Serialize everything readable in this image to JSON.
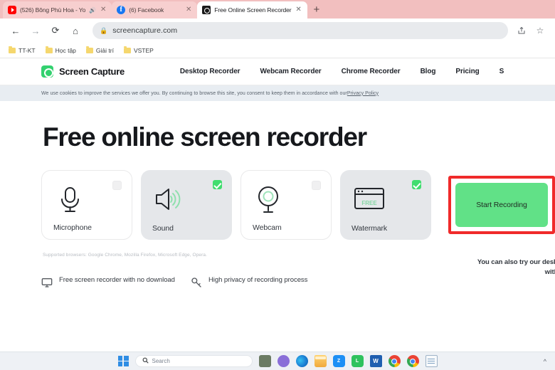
{
  "browser": {
    "tabs": [
      {
        "title": "(526) Bông Phù Hoa - Yo",
        "favicon": "youtube-icon",
        "muted": true,
        "active": false,
        "close_label": "✕"
      },
      {
        "title": "(6) Facebook",
        "favicon": "facebook-icon",
        "muted": false,
        "active": false,
        "close_label": "✕"
      },
      {
        "title": "Free Online Screen Recorder",
        "favicon": "screencapture-icon",
        "muted": false,
        "active": true,
        "close_label": "✕"
      }
    ],
    "new_tab_label": "+",
    "mute_glyph": "🔇",
    "toolbar": {
      "back": "←",
      "forward": "→",
      "reload": "⟳",
      "home": "⌂",
      "lock": "🔒",
      "url": "screencapture.com",
      "share": "share-icon",
      "bookmark_star": "☆"
    },
    "bookmarks": [
      {
        "label": "TT-KT"
      },
      {
        "label": "Học tập"
      },
      {
        "label": "Giải trí"
      },
      {
        "label": "VSTEP"
      }
    ]
  },
  "site": {
    "brand": "Screen Capture",
    "nav": [
      {
        "label": "Desktop Recorder"
      },
      {
        "label": "Webcam Recorder"
      },
      {
        "label": "Chrome Recorder"
      },
      {
        "label": "Blog"
      },
      {
        "label": "Pricing"
      },
      {
        "label": "S"
      }
    ],
    "cookie_notice": {
      "text": "We use cookies to improve the services we offer you. By continuing to browse this site, you consent to keep them in accordance with our ",
      "link": "Privacy Policy"
    },
    "hero_title": "Free online screen recorder",
    "cards": [
      {
        "label": "Microphone",
        "icon": "microphone-icon",
        "checked": false
      },
      {
        "label": "Sound",
        "icon": "speaker-icon",
        "checked": true
      },
      {
        "label": "Webcam",
        "icon": "webcam-icon",
        "checked": false
      },
      {
        "label": "Watermark",
        "icon": "watermark-window-icon",
        "checked": true,
        "badge": "FREE"
      }
    ],
    "start_button": "Start Recording",
    "supported_browsers": "Supported browsers: Google Chrome, Mozilla Firefox, Microsoft Edge, Opera.",
    "features": [
      {
        "text": "Free screen recorder with no download",
        "icon": "monitor-icon"
      },
      {
        "text": "High privacy of recording process",
        "icon": "key-icon"
      }
    ],
    "aside_line1": "You can also try our deskto",
    "aside_line2": "with a"
  },
  "taskbar": {
    "start_label": "windows-start",
    "search_placeholder": "Search",
    "search_icon": "search-icon",
    "apps": [
      {
        "name": "edge"
      },
      {
        "name": "file-explorer"
      },
      {
        "name": "zalo"
      },
      {
        "name": "line"
      },
      {
        "name": "word"
      },
      {
        "name": "chrome"
      },
      {
        "name": "chrome-2"
      },
      {
        "name": "notepad"
      }
    ],
    "overflow_caret": "^"
  },
  "annotation": {
    "highlight_color": "#f02a2a"
  }
}
